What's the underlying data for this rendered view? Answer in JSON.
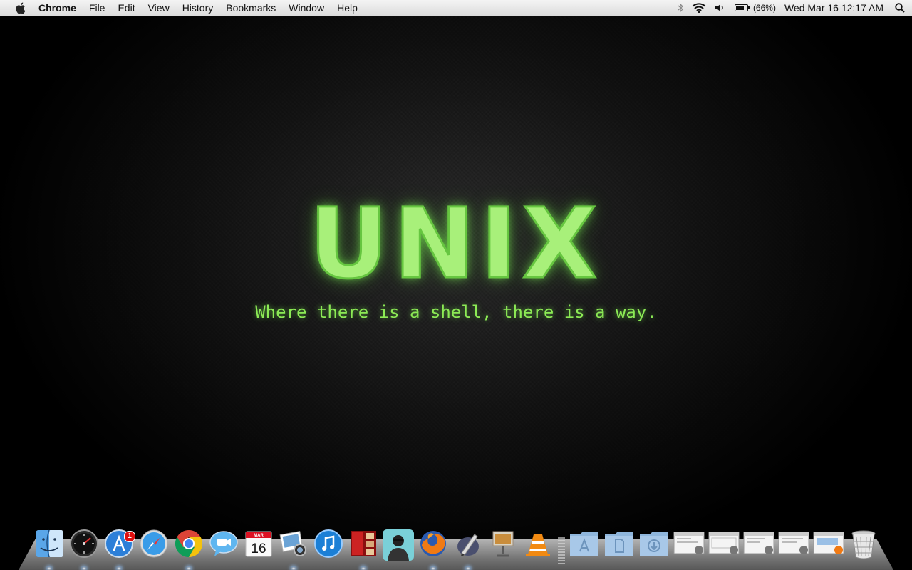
{
  "menubar": {
    "app_name": "Chrome",
    "menus": [
      "File",
      "Edit",
      "View",
      "History",
      "Bookmarks",
      "Window",
      "Help"
    ],
    "status": {
      "bluetooth_icon": "bluetooth-icon",
      "wifi_icon": "wifi-icon",
      "volume_icon": "volume-icon",
      "battery_icon": "battery-icon",
      "battery_percent": "(66%)",
      "clock": "Wed Mar 16  12:17 AM",
      "spotlight_icon": "spotlight-search-icon"
    }
  },
  "wallpaper": {
    "title": "UNIX",
    "tagline": "Where there is a shell, there is a way.",
    "title_color": "#a8f07a",
    "tagline_color": "#8cea55"
  },
  "dock": {
    "apps": [
      {
        "name": "finder-icon",
        "running": true
      },
      {
        "name": "dashboard-icon",
        "running": true
      },
      {
        "name": "app-store-icon",
        "running": true,
        "badge": "1"
      },
      {
        "name": "safari-icon",
        "running": false
      },
      {
        "name": "chrome-icon",
        "running": true
      },
      {
        "name": "ichat-icon",
        "running": false
      },
      {
        "name": "ical-icon",
        "running": false,
        "month": "MAR",
        "day": "16"
      },
      {
        "name": "iphoto-icon",
        "running": true
      },
      {
        "name": "itunes-icon",
        "running": false
      },
      {
        "name": "photo-booth-icon",
        "running": true
      },
      {
        "name": "hacker-avatar-app-icon",
        "running": false
      },
      {
        "name": "firefox-icon",
        "running": true
      },
      {
        "name": "pen-app-icon",
        "running": true
      },
      {
        "name": "keynote-icon",
        "running": false
      },
      {
        "name": "vlc-icon",
        "running": false
      }
    ],
    "stacks": [
      {
        "name": "applications-folder-icon"
      },
      {
        "name": "documents-folder-icon"
      },
      {
        "name": "downloads-folder-icon"
      },
      {
        "name": "minimized-window-icon"
      },
      {
        "name": "minimized-window-icon"
      },
      {
        "name": "minimized-window-icon"
      },
      {
        "name": "minimized-window-icon"
      },
      {
        "name": "minimized-window-firefox-icon"
      },
      {
        "name": "trash-icon"
      }
    ]
  }
}
